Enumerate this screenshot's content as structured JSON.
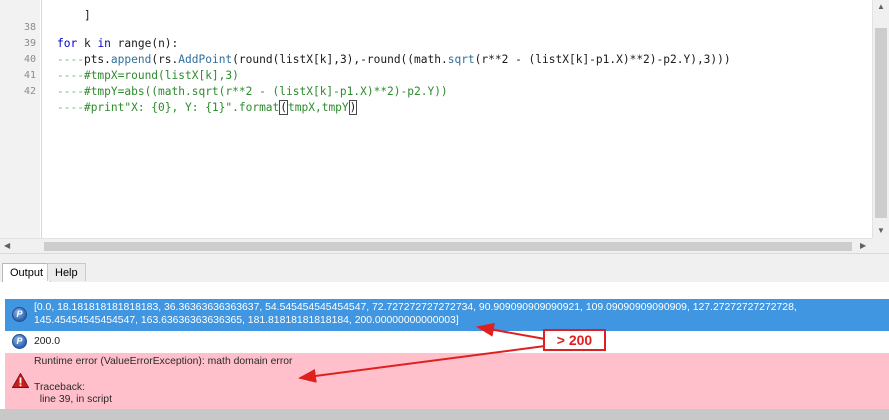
{
  "editor": {
    "lines": [
      {
        "num": "38",
        "keyword_for": "for",
        "k": " k ",
        "keyword_in": "in",
        "rest": " range(n):"
      },
      {
        "num": "39",
        "indent": "----",
        "text_a": "pts.",
        "fn1": "append",
        "text_b": "(rs.",
        "fn2": "AddPoint",
        "text_c": "(round(listX[k],3),-round((math.",
        "fn3": "sqrt",
        "text_d": "(r**2 - (listX[k]-p1.X)**2)-p2.Y),3)))"
      },
      {
        "num": "40",
        "indent": "----",
        "comment": "#tmpX=round(listX[k],3)"
      },
      {
        "num": "41",
        "indent": "----",
        "comment": "#tmpY=abs((math.sqrt(r**2 - (listX[k]-p1.X)**2)-p2.Y))"
      },
      {
        "num": "42",
        "indent": "----",
        "comment_a": "#print\"X: {0}, Y: {1}\".format",
        "open_paren": "(",
        "comment_b": "tmpX,tmpY",
        "close_paren": ")"
      }
    ]
  },
  "output_panel": {
    "tabs": [
      {
        "label": "Output"
      },
      {
        "label": "Help"
      }
    ],
    "messages": [
      {
        "type": "info",
        "icon": "python-icon",
        "text": "[0.0, 18.181818181818183, 36.36363636363637, 54.54545454545454​7, 72.72727272727273​4, 90.90909090909092​1, 109.09090909090909, 127.27272727272728, 145.45454545454547, 163.63636363636365, 181.81818181818184, 200.00000000000003]"
      },
      {
        "type": "info",
        "icon": "python-icon",
        "text": "200.0"
      },
      {
        "type": "error",
        "icon": "warning-icon",
        "line1": "Runtime error (ValueErrorException): math domain error",
        "line2": "Traceback:",
        "line3": "  line 39, in script"
      }
    ]
  },
  "annotation": {
    "label": "> 200",
    "color": "#e02020"
  },
  "colors": {
    "selected_row": "#4096e0",
    "error_row": "#ffc0cb",
    "keyword": "#0000c8",
    "comment": "#2e8b2e"
  }
}
